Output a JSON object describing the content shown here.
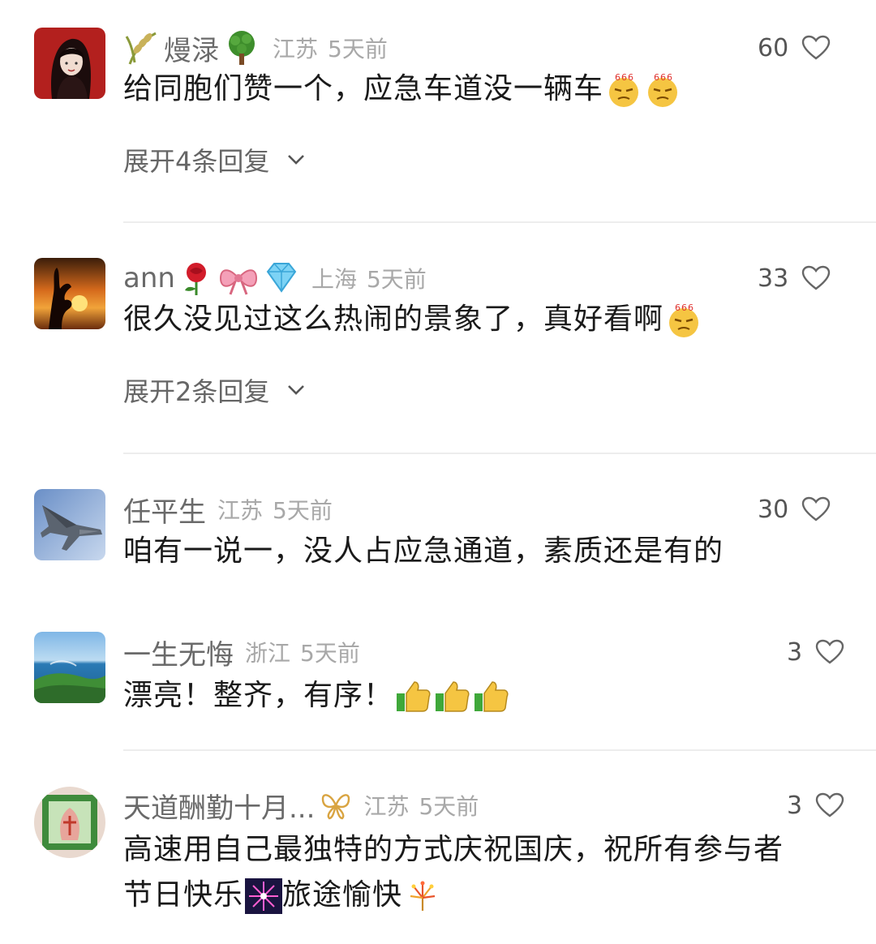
{
  "comments": [
    {
      "username": "熳渌",
      "location": "江苏",
      "time": "5天前",
      "likes": "60",
      "text": "给同胞们赞一个，应急车道没一辆车",
      "expand": "展开4条回复"
    },
    {
      "username": "ann",
      "location": "上海",
      "time": "5天前",
      "likes": "33",
      "text": "很久没见过这么热闹的景象了，真好看啊",
      "expand": "展开2条回复"
    },
    {
      "username": "任平生",
      "location": "江苏",
      "time": "5天前",
      "likes": "30",
      "text": "咱有一说一，没人占应急通道，素质还是有的"
    },
    {
      "username": "一生无悔",
      "location": "浙江",
      "time": "5天前",
      "likes": "3",
      "text": "漂亮！整齐，有序！"
    },
    {
      "username": "天道酬勤十月...",
      "location": "江苏",
      "time": "5天前",
      "likes": "3",
      "text_line1": "高速用自己最独特的方式庆祝国庆，祝所有参与者",
      "text_line2a": "节日快乐",
      "text_line2b": "旅途愉快"
    }
  ],
  "emoji": {
    "emoji_666": "666"
  },
  "colors": {
    "username": "#6a6a6a",
    "meta": "#a8a8a8",
    "text": "#1a1a1a",
    "divider": "#ededed"
  }
}
